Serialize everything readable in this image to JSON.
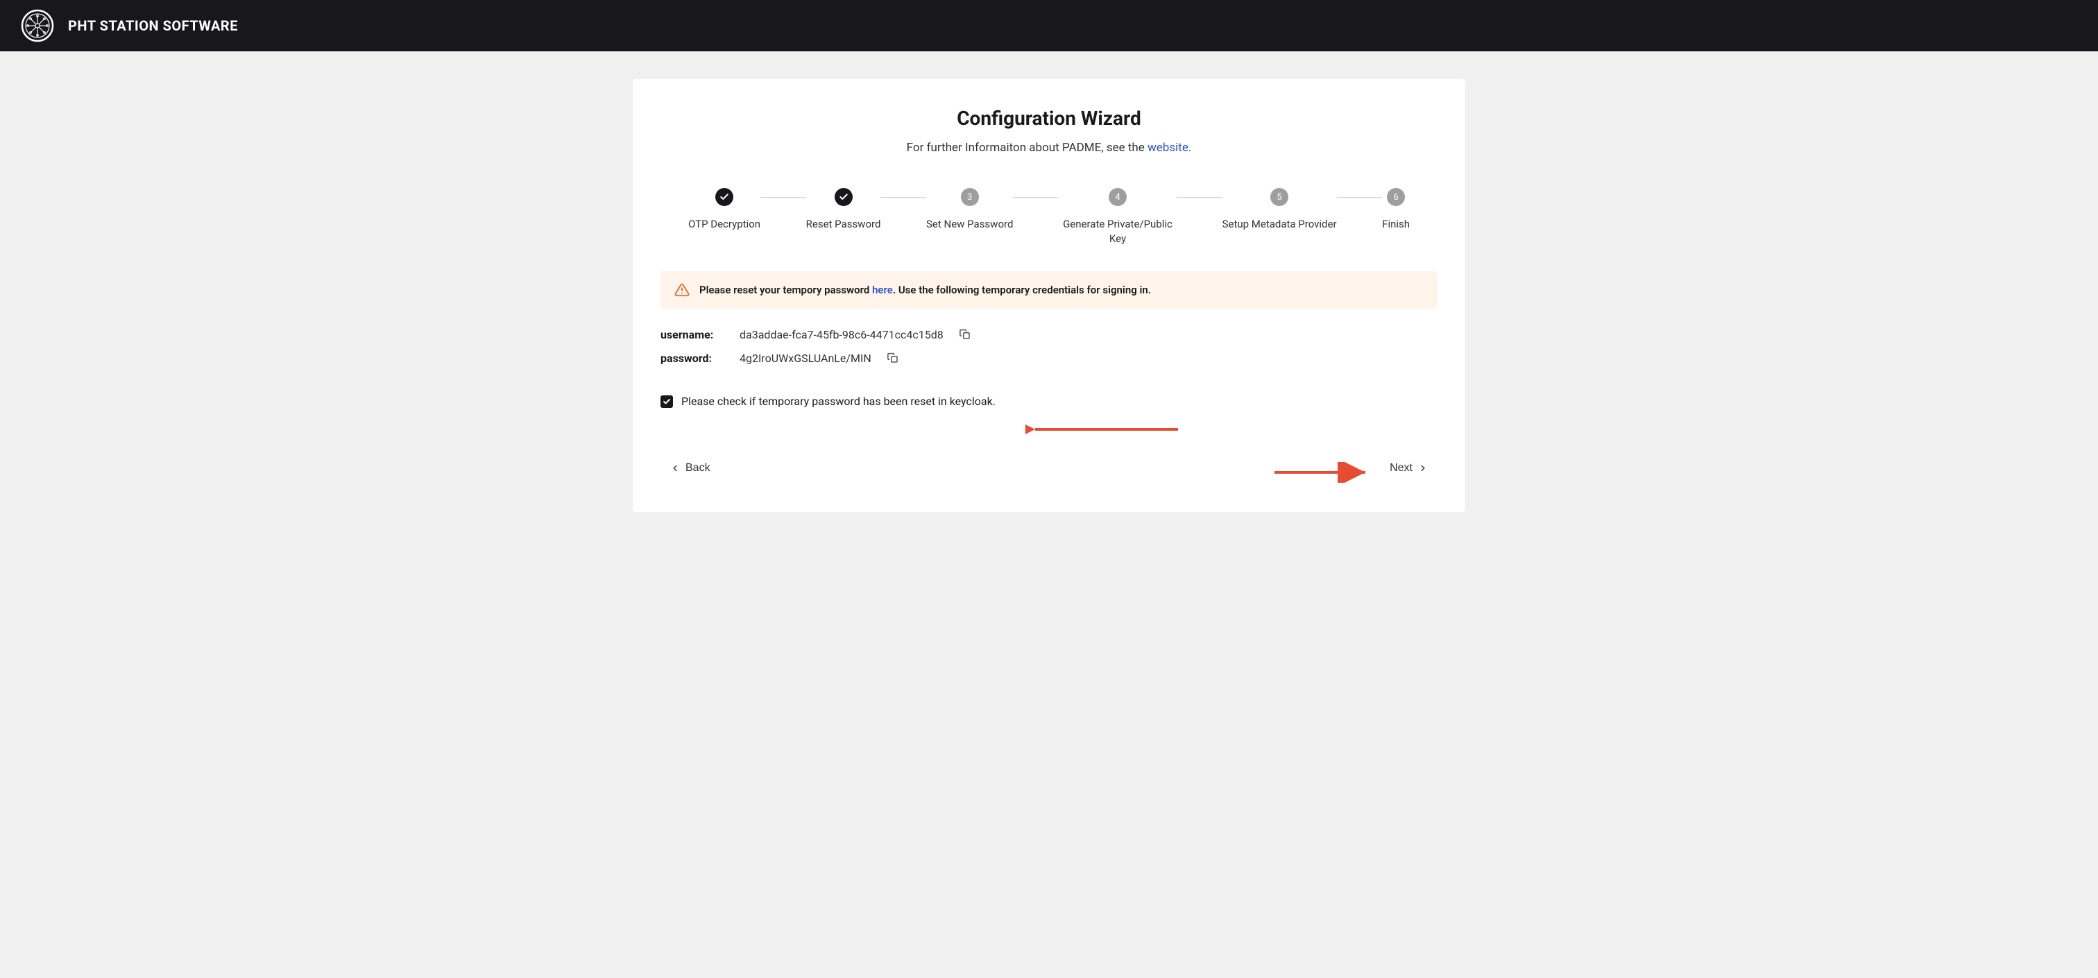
{
  "header": {
    "title": "PHT STATION SOFTWARE"
  },
  "page": {
    "title": "Configuration Wizard",
    "subtitle_prefix": "For further Informaiton about PADME, see the ",
    "subtitle_link": "website",
    "subtitle_suffix": "."
  },
  "steps": [
    {
      "label": "OTP Decryption",
      "state": "done"
    },
    {
      "label": "Reset Password",
      "state": "done"
    },
    {
      "label": "Set New Password",
      "state": "pending",
      "num": "3"
    },
    {
      "label": "Generate Private/Public Key",
      "state": "pending",
      "num": "4"
    },
    {
      "label": "Setup Metadata Provider",
      "state": "pending",
      "num": "5"
    },
    {
      "label": "Finish",
      "state": "pending",
      "num": "6"
    }
  ],
  "alert": {
    "prefix": "Please reset your tempory password ",
    "link": "here",
    "suffix": ". Use the following temporary credentials for signing in."
  },
  "credentials": {
    "username_label": "username:",
    "username_value": "da3addae-fca7-45fb-98c6-4471cc4c15d8",
    "password_label": "password:",
    "password_value": "4g2IroUWxGSLUAnLe/MIN"
  },
  "checkbox": {
    "checked": true,
    "label": "Please check if temporary password has been reset in keycloak."
  },
  "nav": {
    "back": "Back",
    "next": "Next"
  },
  "annotations": {
    "arrow_color": "#e84b33"
  }
}
